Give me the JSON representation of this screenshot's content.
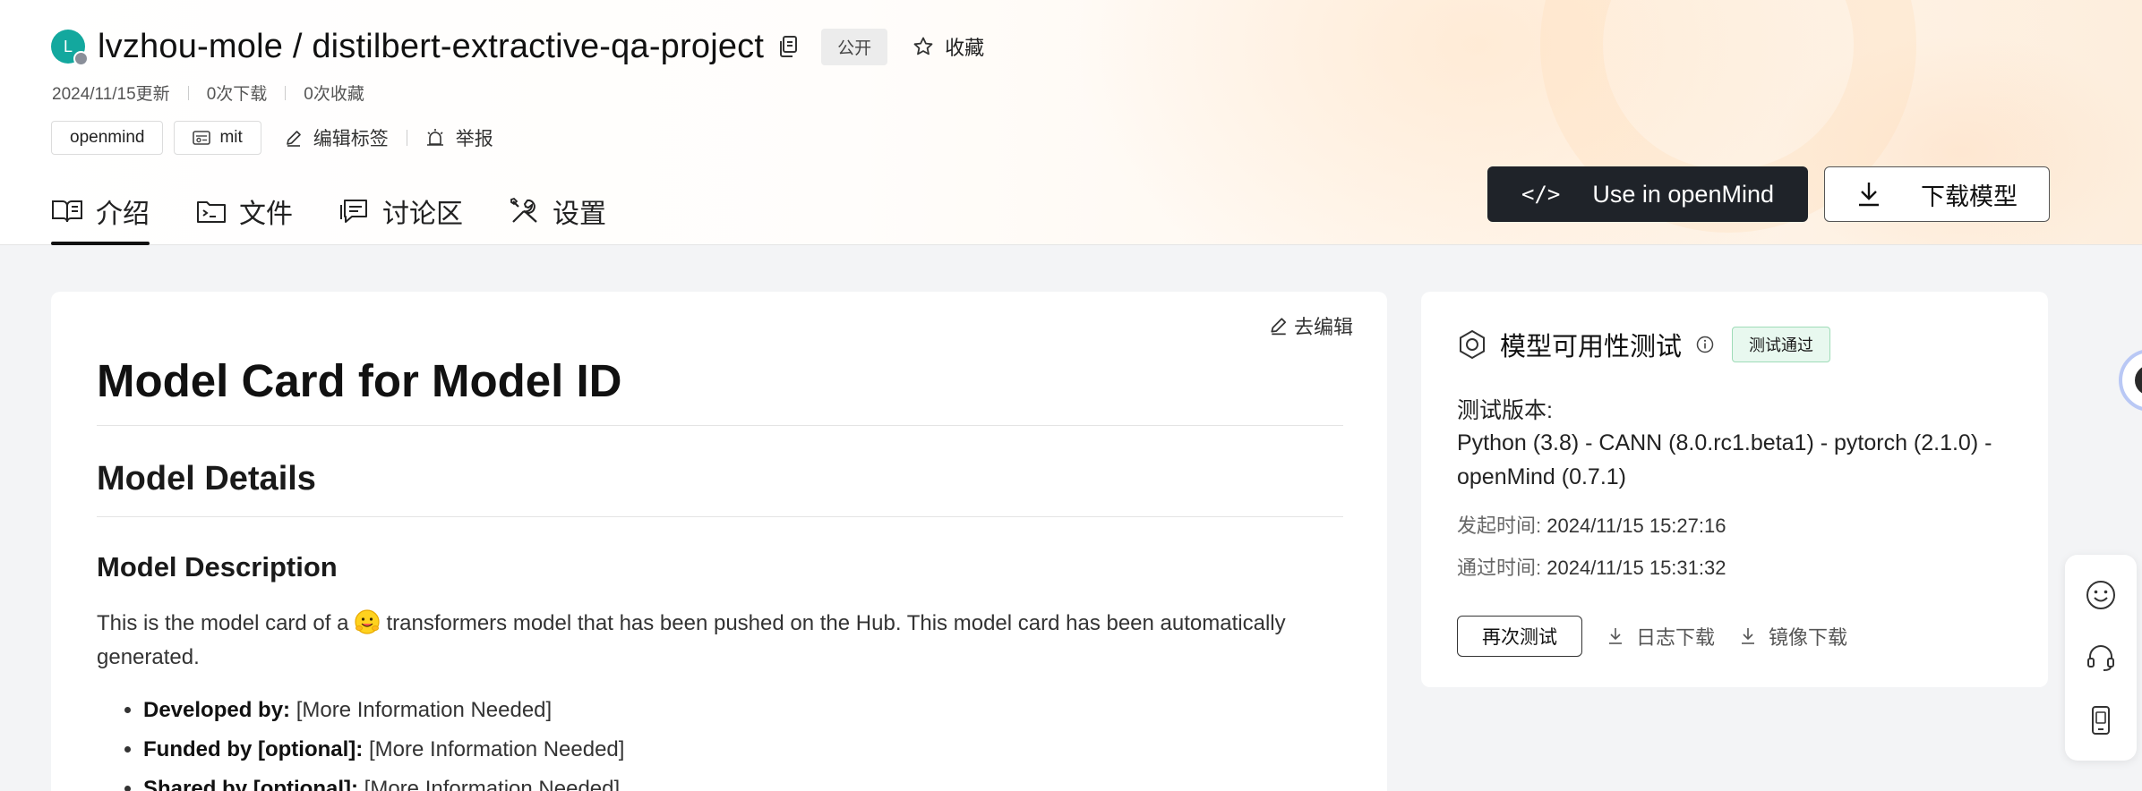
{
  "header": {
    "avatar_letter": "L",
    "repo_title": "lvzhou-mole / distilbert-extractive-qa-project",
    "visibility": "公开",
    "favorite_label": "收藏",
    "updated": "2024/11/15更新",
    "downloads": "0次下载",
    "favorites": "0次收藏",
    "tags": [
      "openmind",
      "mit"
    ],
    "edit_tags_label": "编辑标签",
    "report_label": "举报"
  },
  "tabs": [
    {
      "label": "介绍",
      "active": true
    },
    {
      "label": "文件",
      "active": false
    },
    {
      "label": "讨论区",
      "active": false
    },
    {
      "label": "设置",
      "active": false
    }
  ],
  "actions": {
    "use_label": "Use in openMind",
    "use_code": "</>",
    "download_label": "下载模型"
  },
  "content": {
    "edit_label": "去编辑",
    "h1": "Model Card for Model ID",
    "h2": "Model Details",
    "h3": "Model Description",
    "para_before": "This is the model card of a",
    "para_after": "transformers model that has been pushed on the Hub. This model card has been automatically generated.",
    "list": [
      {
        "key": "Developed by:",
        "value": "[More Information Needed]"
      },
      {
        "key": "Funded by [optional]:",
        "value": "[More Information Needed]"
      },
      {
        "key": "Shared by [optional]:",
        "value": "[More Information Needed]"
      }
    ]
  },
  "sidebar": {
    "title": "模型可用性测试",
    "status": "测试通过",
    "version_label": "测试版本:",
    "version_value": "Python (3.8) - CANN (8.0.rc1.beta1) - pytorch (2.1.0) - openMind (0.7.1)",
    "start_label": "发起时间:",
    "start_value": "2024/11/15 15:27:16",
    "pass_label": "通过时间:",
    "pass_value": "2024/11/15 15:31:32",
    "retest_label": "再次测试",
    "log_label": "日志下载",
    "image_label": "镜像下载"
  },
  "colors": {
    "primary_dark": "#1f2329",
    "avatar": "#13a89e",
    "success_bg": "#e8f8ef",
    "success_border": "#9fdcb8"
  },
  "icons": {
    "float_bar": [
      "smile-icon",
      "headset-icon",
      "phone-icon"
    ]
  }
}
